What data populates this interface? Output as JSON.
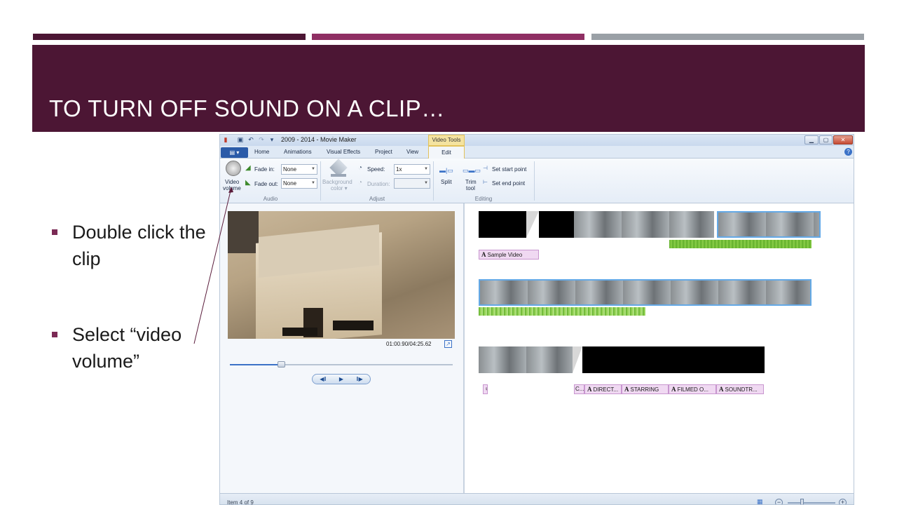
{
  "slide": {
    "title": "TO TURN OFF SOUND ON A CLIP…",
    "accent_colors": [
      "#4c1634",
      "#8f2f63",
      "#9aa0a6"
    ],
    "title_band_color": "#4c1634",
    "bullets": [
      "Double click the clip",
      "Select “video volume”"
    ]
  },
  "window": {
    "title": "2009 - 2014 - Movie Maker",
    "contextual_tab": "Video Tools",
    "quick_access": [
      "save-icon",
      "undo-icon",
      "redo-icon",
      "dropdown-icon"
    ],
    "window_buttons": [
      "minimize",
      "maximize",
      "close"
    ]
  },
  "tabs": {
    "file_glyph": "▤ ▾",
    "items": [
      "Home",
      "Animations",
      "Visual Effects",
      "Project",
      "View"
    ],
    "active": "Edit"
  },
  "ribbon": {
    "audio": {
      "group_label": "Audio",
      "video_volume_line1": "Video",
      "video_volume_line2": "volume",
      "fade_in_label": "Fade in:",
      "fade_in_value": "None",
      "fade_out_label": "Fade out:",
      "fade_out_value": "None"
    },
    "adjust": {
      "group_label": "Adjust",
      "background_color_line1": "Background",
      "background_color_line2": "color ▾",
      "speed_label": "Speed:",
      "speed_value": "1x",
      "duration_label": "Duration:",
      "duration_value": ""
    },
    "editing": {
      "group_label": "Editing",
      "split_label": "Split",
      "trim_tool_line1": "Trim",
      "trim_tool_line2": "tool",
      "set_start_point": "Set start point",
      "set_end_point": "Set end point"
    }
  },
  "preview": {
    "time_readout": "01:00.90/04:25.62",
    "seek_position": 0.23,
    "controls": [
      "◀‖",
      "▶",
      "‖▶"
    ]
  },
  "timeline": {
    "row1_caption": "Sample Video",
    "row3_captions": [
      "C...",
      "DIRECT...",
      "STARRING",
      "FILMED O...",
      "SOUNDTR..."
    ],
    "small_marker": "♀"
  },
  "status": {
    "text": "Item 4 of 9",
    "zoom_minus": "−",
    "zoom_plus": "+"
  }
}
